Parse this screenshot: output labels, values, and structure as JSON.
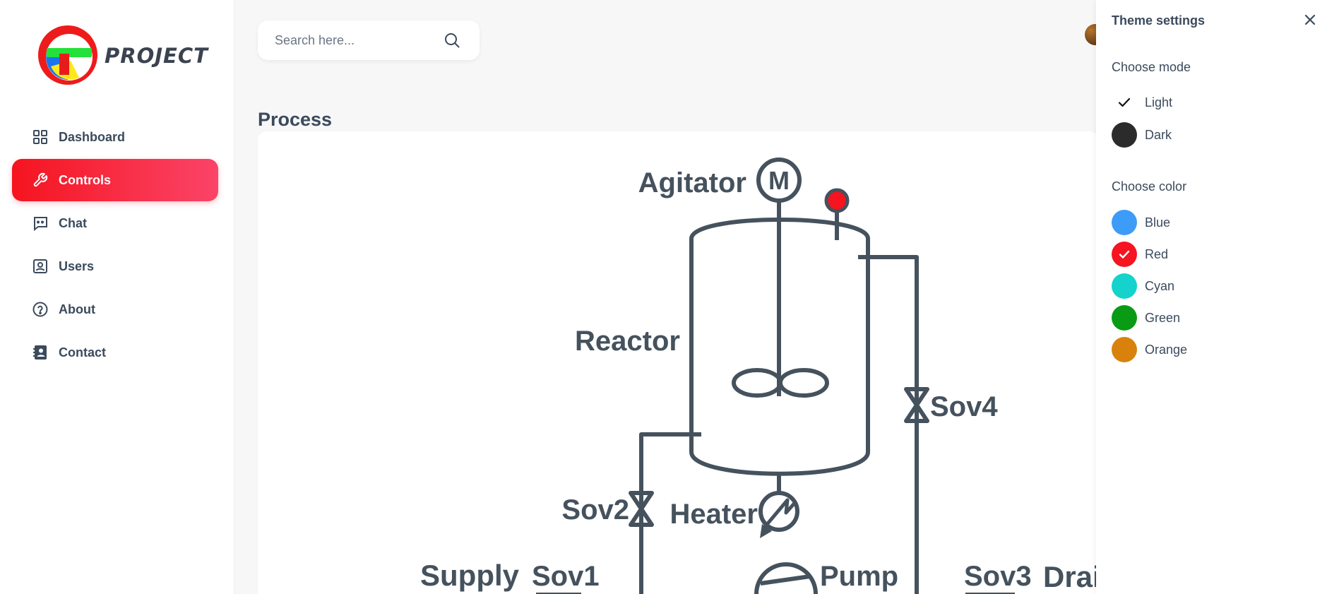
{
  "app": {
    "logo_text": "PROJECT"
  },
  "sidebar": {
    "items": [
      {
        "label": "Dashboard",
        "icon": "grid-icon",
        "active": false
      },
      {
        "label": "Controls",
        "icon": "wrench-icon",
        "active": true
      },
      {
        "label": "Chat",
        "icon": "chat-icon",
        "active": false
      },
      {
        "label": "Users",
        "icon": "user-badge-icon",
        "active": false
      },
      {
        "label": "About",
        "icon": "question-circle-icon",
        "active": false
      },
      {
        "label": "Contact",
        "icon": "contact-book-icon",
        "active": false
      }
    ]
  },
  "search": {
    "placeholder": "Search here...",
    "value": ""
  },
  "main": {
    "title": "Process"
  },
  "diagram": {
    "labels": {
      "agitator": "Agitator",
      "motor": "M",
      "reactor": "Reactor",
      "sov4": "Sov4",
      "sov2": "Sov2",
      "heater": "Heater",
      "supply": "Supply",
      "sov1": "Sov1",
      "pump": "Pump",
      "sov3": "Sov3",
      "drain": "Drain"
    },
    "line_color": "#45525e",
    "sensor_color": "#f5141f"
  },
  "theme_panel": {
    "title": "Theme settings",
    "mode_title": "Choose mode",
    "modes": [
      {
        "label": "Light",
        "selected": true
      },
      {
        "label": "Dark",
        "selected": false,
        "color": "#2b2b2b"
      }
    ],
    "color_title": "Choose color",
    "colors": [
      {
        "label": "Blue",
        "color": "#3d9cf7",
        "selected": false
      },
      {
        "label": "Red",
        "color": "#f5141f",
        "selected": true
      },
      {
        "label": "Cyan",
        "color": "#13d3cc",
        "selected": false
      },
      {
        "label": "Green",
        "color": "#0a9b14",
        "selected": false
      },
      {
        "label": "Orange",
        "color": "#d8820d",
        "selected": false
      }
    ]
  },
  "accent_color": "#f5141f"
}
